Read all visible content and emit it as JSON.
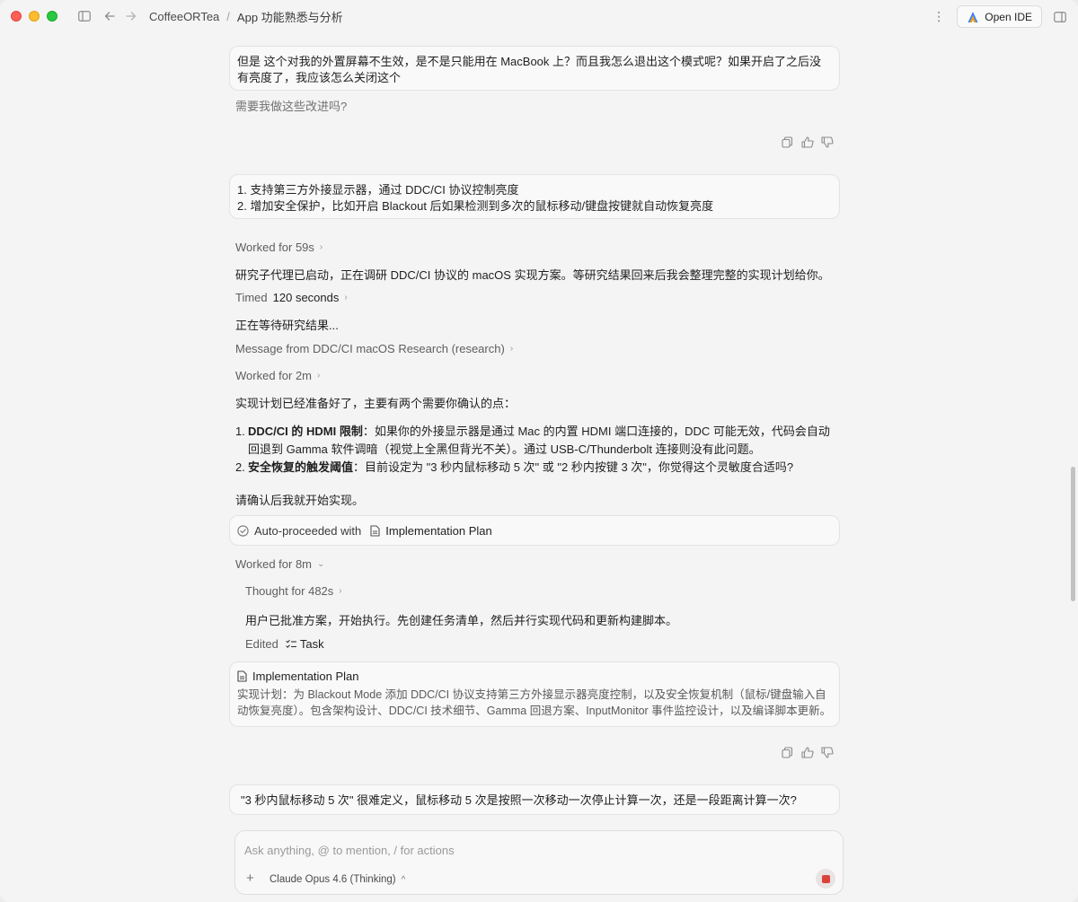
{
  "titlebar": {
    "breadcrumb_root": "CoffeeORTea",
    "breadcrumb_sep": "/",
    "breadcrumb_page": "App 功能熟悉与分析",
    "more_glyph": "⋮",
    "open_ide_label": "Open IDE"
  },
  "messages": {
    "user1": "但是 这个对我的外置屏幕不生效，是不是只能用在 MacBook 上？而且我怎么退出这个模式呢？如果开启了之后没有亮度了，我应该怎么关闭这个",
    "assistant_tail": "需要我做这些改进吗?",
    "user2_line1": "1. 支持第三方外接显示器，通过 DDC/CI 协议控制亮度",
    "user2_line2": "2. 增加安全保护，比如开启 Blackout 后如果检测到多次的鼠标移动/键盘按键就自动恢复亮度",
    "worked1": "Worked for 59s",
    "research_started": "研究子代理已启动，正在调研 DDC/CI 协议的 macOS 实现方案。等研究结果回来后我会整理完整的实现计划给你。",
    "timed_prefix": "Timed",
    "timed_value": "120 seconds",
    "waiting": "正在等待研究结果...",
    "message_from": "Message from DDC/CI macOS Research (research)",
    "worked2": "Worked for 2m",
    "plan_ready": "实现计划已经准备好了，主要有两个需要你确认的点：",
    "list": [
      {
        "num": "1.",
        "bold": "DDC/CI 的 HDMI 限制",
        "text": "：如果你的外接显示器是通过 Mac 的内置 HDMI 端口连接的，DDC 可能无效，代码会自动回退到 Gamma 软件调暗（视觉上全黑但背光不关）。通过 USB-C/Thunderbolt 连接则没有此问题。"
      },
      {
        "num": "2.",
        "bold": "安全恢复的触发阈值",
        "text": "：目前设定为 \"3 秒内鼠标移动 5 次\" 或 \"2 秒内按键 3 次\"，你觉得这个灵敏度合适吗?"
      }
    ],
    "confirm": "请确认后我就开始实现。",
    "auto_proceeded": "Auto-proceeded with",
    "auto_plan_label": "Implementation Plan",
    "worked3": "Worked for 8m",
    "thought": "Thought for 482s",
    "approved": "用户已批准方案，开始执行。先创建任务清单，然后并行实现代码和更新构建脚本。",
    "edited_prefix": "Edited",
    "edited_target": "Task",
    "plan_card_title": "Implementation Plan",
    "plan_card_body": "实现计划：为 Blackout Mode 添加 DDC/CI 协议支持第三方外接显示器亮度控制，以及安全恢复机制（鼠标/键盘输入自动恢复亮度）。包含架构设计、DDC/CI 技术细节、Gamma 回退方案、InputMonitor 事件监控设计，以及编译脚本更新。",
    "user3": "\"3 秒内鼠标移动 5 次\" 很难定义，鼠标移动 5 次是按照一次移动一次停止计算一次，还是一段距离计算一次?"
  },
  "composer": {
    "placeholder": "Ask anything, @ to mention, / for actions",
    "plus": "+",
    "model": "Claude Opus 4.6 (Thinking)",
    "model_chevron": "^"
  }
}
